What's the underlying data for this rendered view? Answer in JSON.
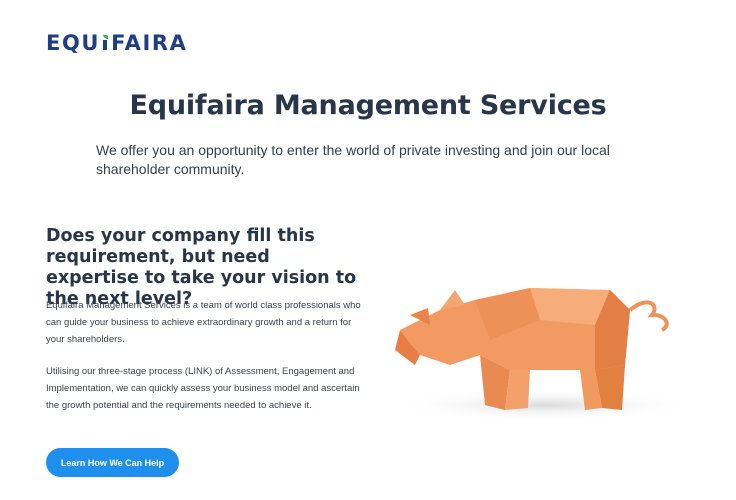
{
  "brand": {
    "logo_text": "EQUIFAIRA",
    "logo_prefix": "EQU",
    "logo_i": "I",
    "logo_suffix": "FAIRA",
    "colors": {
      "logo": "#1e3f86",
      "logo_leaf": "#3fae49",
      "accent": "#1f8fee",
      "heading": "#27364a"
    }
  },
  "hero": {
    "title": "Equifaira Management Services",
    "subtitle": "We offer you an opportunity to enter the world of private investing and join our local shareholder community."
  },
  "section": {
    "title": "Does your company fill this requirement, but need expertise to take your vision to the next level?",
    "paragraph1": "Equifaira Management Services is a team of world class professionals who can guide your business to achieve extraordinary growth and a return for your shareholders.",
    "paragraph2": "Utilising our three-stage process (LINK) of Assessment, Engagement and Implementation, we can quickly assess your business model and ascertain the growth potential and the requirements needed to achieve it.",
    "cta_label": "Learn How We Can Help"
  },
  "image": {
    "icon": "origami-pig-image",
    "color": "#f08a50"
  }
}
